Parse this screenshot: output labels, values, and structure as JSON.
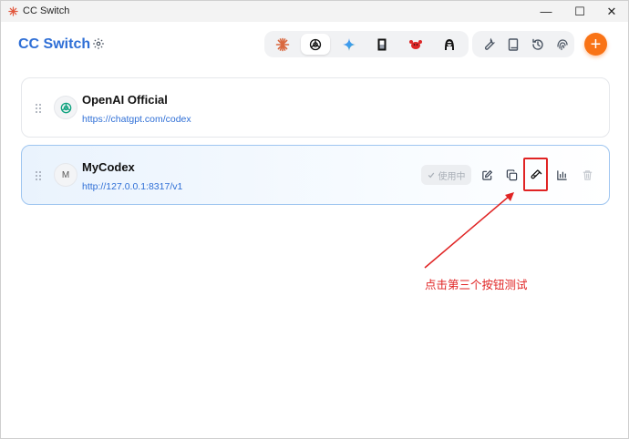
{
  "window": {
    "title": "CC Switch",
    "minimize_glyph": "—",
    "maximize_glyph": "☐",
    "close_glyph": "✕"
  },
  "header": {
    "brand": "CC Switch",
    "settings_icon": "gear-icon",
    "app_tools": [
      {
        "icon": "claude-icon",
        "active": false
      },
      {
        "icon": "openai-icon",
        "active": true
      },
      {
        "icon": "gemini-icon",
        "active": false
      },
      {
        "icon": "opencode-icon",
        "active": false
      },
      {
        "icon": "red-crab-icon",
        "active": false
      },
      {
        "icon": "agent-avatar-icon",
        "active": false
      }
    ],
    "utility_tools": [
      "wrench-icon",
      "book-icon",
      "history-icon",
      "fingerprint-icon"
    ],
    "add_label": "+"
  },
  "providers": [
    {
      "name": "OpenAI Official",
      "url": "https://chatgpt.com/codex",
      "icon": "openai-icon",
      "initial": ""
    },
    {
      "name": "MyCodex",
      "url": "http://127.0.0.1:8317/v1",
      "icon": "letter-avatar",
      "initial": "M",
      "use_label": "使用中",
      "actions": [
        "edit-icon",
        "duplicate-icon",
        "test-icon",
        "stats-icon",
        "delete-icon"
      ]
    }
  ],
  "annotation": {
    "text": "点击第三个按钮测试",
    "color": "#e02424"
  },
  "colors": {
    "brand": "#2f6fd6",
    "accent": "#f97316",
    "active_border": "#9ec5f0"
  }
}
